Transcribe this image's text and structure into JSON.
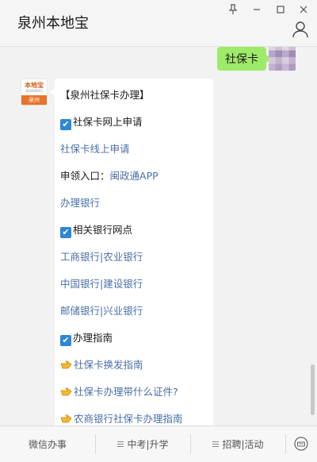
{
  "window": {
    "title": "泉州本地宝",
    "controls": [
      "pin-icon",
      "minimize-icon",
      "maximize-icon",
      "close-icon"
    ]
  },
  "messages": {
    "outgoing_text": "社保卡",
    "avatar_logo_text": "本地宝",
    "avatar_banner": "泉州",
    "card": {
      "header": "【泉州社保卡办理】",
      "section1_title": "社保卡网上申请",
      "link_online_apply": "社保卡线上申请",
      "entrance_label": "申领入口：",
      "entrance_link": "闽政通APP",
      "link_bank": "办理银行",
      "section2_title": "相关银行网点",
      "bank_row1_a": "工商银行",
      "bank_row1_b": "农业银行",
      "bank_row2_a": "中国银行",
      "bank_row2_b": "建设银行",
      "bank_row3_a": "邮储银行",
      "bank_row3_b": "兴业银行",
      "separator": "|",
      "section3_title": "办理指南",
      "guide1": "社保卡换发指南",
      "guide2": "社保卡办理带什么证件?",
      "guide3": "农商银行社保卡办理指南"
    }
  },
  "bottom_menu": {
    "item1": "微信办事",
    "item2": "中考|升学",
    "item3": "招聘|活动"
  },
  "colors": {
    "outgoing_bubble": "#9eea6a",
    "link": "#4a6fa5",
    "checkbox": "#2d86d8",
    "brand_orange": "#e8732a"
  }
}
